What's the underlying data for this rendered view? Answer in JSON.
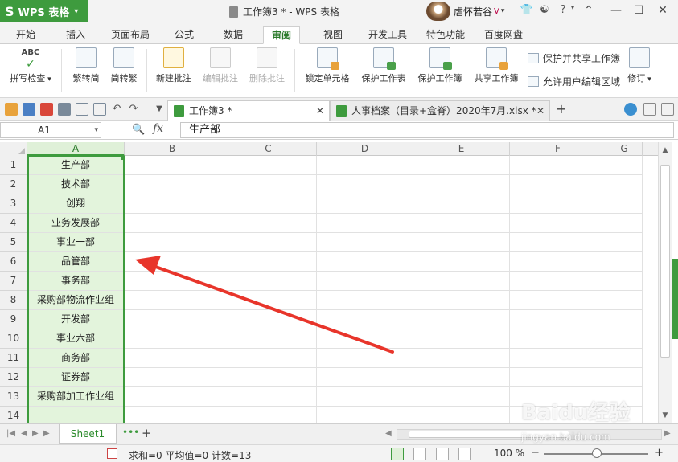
{
  "app": {
    "name": "WPS 表格",
    "window_title": "工作簿3 * - WPS 表格",
    "user_name": "虐怀若谷",
    "user_badge": "V"
  },
  "menu": {
    "tabs": [
      "开始",
      "插入",
      "页面布局",
      "公式",
      "数据",
      "审阅",
      "视图",
      "开发工具",
      "特色功能",
      "百度网盘"
    ],
    "active": "审阅"
  },
  "ribbon": {
    "spellcheck": "拼写检查",
    "spellcheck_icon_text": "ABC",
    "to_traditional": "繁转简",
    "to_simplified": "简转繁",
    "new_comment": "新建批注",
    "edit_comment": "编辑批注",
    "delete_comment": "删除批注",
    "lock_cell": "锁定单元格",
    "protect_sheet": "保护工作表",
    "protect_workbook": "保护工作簿",
    "share_workbook": "共享工作簿",
    "protect_and_share": "保护并共享工作簿",
    "allow_edit_ranges": "允许用户编辑区域",
    "track_changes": "修订"
  },
  "doc_tabs": [
    {
      "label": "工作簿3 *",
      "active": true
    },
    {
      "label": "人事档案（目录+盒脊）2020年7月.xlsx *",
      "active": false
    }
  ],
  "formula_bar": {
    "name_box": "A1",
    "fx_label": "fx",
    "value": "生产部"
  },
  "grid": {
    "columns": [
      "A",
      "B",
      "C",
      "D",
      "E",
      "F",
      "G"
    ],
    "selected_column": "A",
    "rows": [
      {
        "num": "1",
        "a": "生产部"
      },
      {
        "num": "2",
        "a": "技术部"
      },
      {
        "num": "3",
        "a": "创翔"
      },
      {
        "num": "4",
        "a": "业务发展部"
      },
      {
        "num": "5",
        "a": "事业一部"
      },
      {
        "num": "6",
        "a": "品管部"
      },
      {
        "num": "7",
        "a": "事务部"
      },
      {
        "num": "8",
        "a": "采购部物流作业组"
      },
      {
        "num": "9",
        "a": "开发部"
      },
      {
        "num": "10",
        "a": "事业六部"
      },
      {
        "num": "11",
        "a": "商务部"
      },
      {
        "num": "12",
        "a": "证券部"
      },
      {
        "num": "13",
        "a": "采购部加工作业组"
      },
      {
        "num": "14",
        "a": ""
      }
    ]
  },
  "sheets": {
    "active": "Sheet1",
    "add_label": "+"
  },
  "status": {
    "text": "求和=0  平均值=0  计数=13",
    "zoom": "100 %"
  },
  "watermark": {
    "main": "Baidu经验",
    "sub": "jingyan.baidu.com"
  },
  "colors": {
    "accent_green": "#3e9b3e",
    "selection_fill": "#e3f4dc",
    "annotation_arrow": "#e8352b"
  }
}
